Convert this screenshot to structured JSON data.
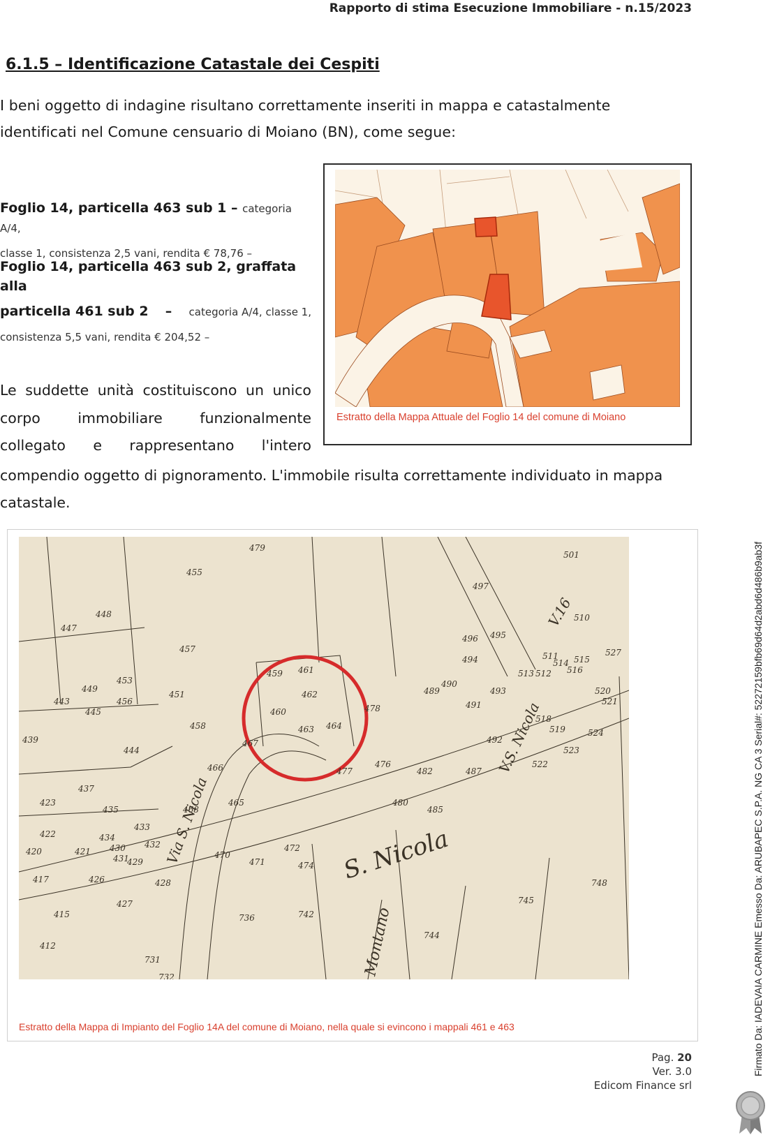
{
  "header": {
    "title": "Rapporto di stima Esecuzione Immobiliare - n.15/2023"
  },
  "section": {
    "number": "6.1.5",
    "heading": "6.1.5 – Identificazione Catastale dei Cespiti"
  },
  "intro": {
    "text": "I beni oggetto di indagine risultano correttamente inseriti in mappa e catastalmente identificati nel Comune censuario di Moiano (BN), come segue:"
  },
  "parcels": [
    {
      "title": "Foglio 14, particella 463 sub 1",
      "dash": " – ",
      "details_a": "categoria A/4,",
      "details_b": "classe 1, consistenza 2,5 vani, rendita € 78,76 –"
    },
    {
      "title_a": "Foglio 14, particella 463 sub 2, graffata alla",
      "title_b": "particella 461 sub 2",
      "dash": "–",
      "details_a": "categoria A/4, classe 1,",
      "details_b": "consistenza 5,5 vani, rendita € 204,52 –"
    }
  ],
  "body": {
    "line1": [
      "Le",
      "suddette",
      "unità",
      "costituiscono",
      "un",
      "unico"
    ],
    "line2": [
      "corpo",
      "immobiliare",
      "funzionalmente"
    ],
    "line3": [
      "collegato",
      "e",
      "rappresentano",
      "l'intero"
    ],
    "continuation": "compendio oggetto di pignoramento. L'immobile risulta correttamente individuato in mappa catastale."
  },
  "figures": {
    "current_map": {
      "caption": "Estratto della Mappa Attuale del Foglio 14 del comune di Moiano",
      "highlight_color": "#e8552c",
      "parcel_color": "#f0924d",
      "background_color": "#fbf3e6"
    },
    "historic_map": {
      "caption": "Estratto della Mappa di Impianto del Foglio 14A del comune di Moiano, nella quale si evincono i mappali 461 e 463",
      "street_labels": [
        "S. Nicola",
        "V.S. Nicola",
        "Via S. Nicola",
        "Montano",
        "V.16"
      ],
      "parcel_labels": [
        "479",
        "455",
        "448",
        "447",
        "457",
        "453",
        "449",
        "443",
        "445",
        "456",
        "451",
        "458",
        "439",
        "444",
        "437",
        "423",
        "435",
        "422",
        "433",
        "434",
        "430",
        "421",
        "432",
        "429",
        "420",
        "431",
        "426",
        "417",
        "427",
        "428",
        "415",
        "412",
        "466",
        "467",
        "468",
        "465",
        "470",
        "471",
        "472",
        "474",
        "459",
        "461",
        "460",
        "462",
        "463",
        "464",
        "478",
        "477",
        "476",
        "480",
        "482",
        "485",
        "487",
        "489",
        "490",
        "491",
        "492",
        "493",
        "494",
        "495",
        "496",
        "497",
        "501",
        "510",
        "511",
        "512",
        "513",
        "514",
        "515",
        "516",
        "518",
        "519",
        "520",
        "521",
        "522",
        "523",
        "524",
        "527",
        "731",
        "732",
        "736",
        "742",
        "744",
        "745",
        "748"
      ],
      "highlight_color": "#d62b2b"
    }
  },
  "footer": {
    "page_label": "Pag.",
    "page_number": "20",
    "version": "Ver. 3.0",
    "company": "Edicom Finance srl"
  },
  "signature": {
    "text": "Firmato Da: IADEVAIA CARMINE Emesso Da: ARUBAPEC S.P.A. NG CA 3 Serial#: 52272159bfb69d64d2abd6d486b9ab3f"
  }
}
